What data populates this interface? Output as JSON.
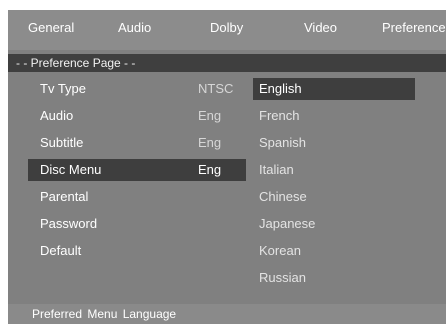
{
  "tabs": [
    {
      "label": "General"
    },
    {
      "label": "Audio"
    },
    {
      "label": "Dolby"
    },
    {
      "label": "Video"
    },
    {
      "label": "Preference"
    }
  ],
  "page_header": "- - Preference Page - -",
  "settings": [
    {
      "label": "Tv Type",
      "value": "NTSC"
    },
    {
      "label": "Audio",
      "value": "Eng"
    },
    {
      "label": "Subtitle",
      "value": "Eng"
    },
    {
      "label": "Disc Menu",
      "value": "Eng"
    },
    {
      "label": "Parental",
      "value": ""
    },
    {
      "label": "Password",
      "value": ""
    },
    {
      "label": "Default",
      "value": ""
    }
  ],
  "selected_setting": "Disc Menu",
  "languages": [
    "English",
    "French",
    "Spanish",
    "Italian",
    "Chinese",
    "Japanese",
    "Korean",
    "Russian"
  ],
  "selected_language": "English",
  "footer_hint": "Preferred Menu Language",
  "colors": {
    "background": "#808080",
    "highlight": "#3e3e3e",
    "text": "#ffffff"
  }
}
